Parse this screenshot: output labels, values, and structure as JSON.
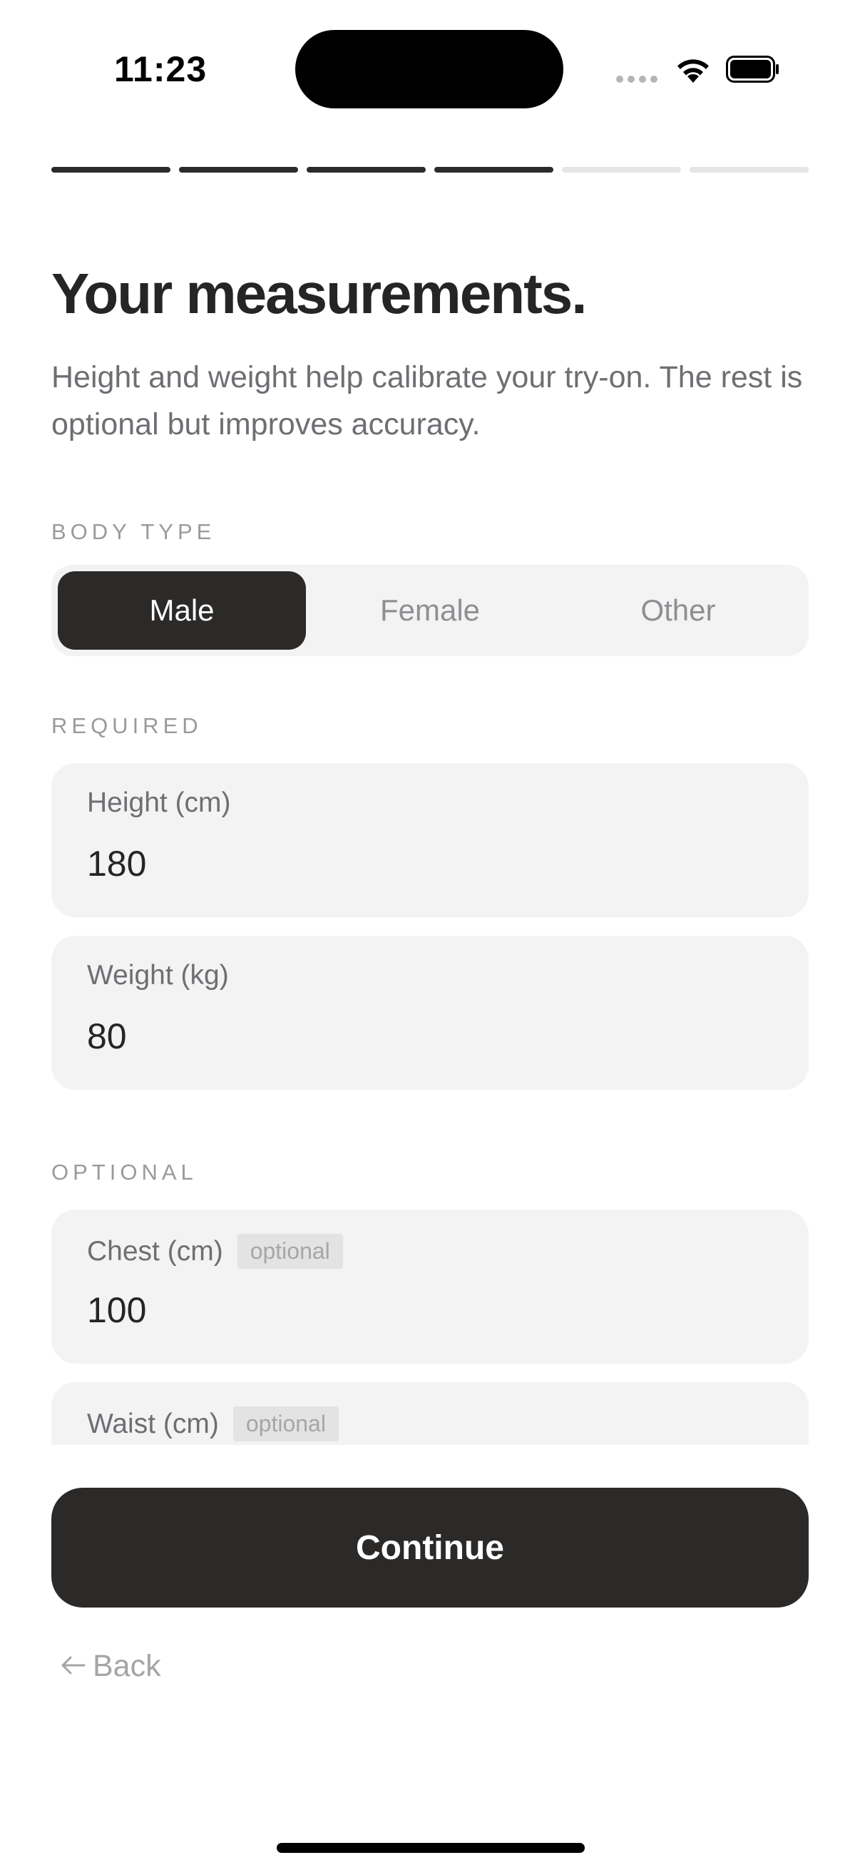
{
  "status_bar": {
    "time": "11:23"
  },
  "progress": {
    "total_steps": 6,
    "completed_steps": 4
  },
  "header": {
    "title": "Your measurements.",
    "subtitle": "Height and weight help calibrate your try-on. The rest is optional but improves accuracy."
  },
  "body_type": {
    "section_label": "BODY TYPE",
    "options": [
      "Male",
      "Female",
      "Other"
    ],
    "selected": "Male"
  },
  "required": {
    "section_label": "REQUIRED",
    "fields": [
      {
        "label": "Height (cm)",
        "value": "180"
      },
      {
        "label": "Weight (kg)",
        "value": "80"
      }
    ]
  },
  "optional": {
    "section_label": "OPTIONAL",
    "badge": "optional",
    "fields": [
      {
        "label": "Chest (cm)",
        "value": "100"
      },
      {
        "label": "Waist (cm)",
        "value": ""
      }
    ]
  },
  "actions": {
    "continue_label": "Continue",
    "back_label": "Back"
  },
  "colors": {
    "accent": "#2b2a29",
    "field_bg": "#f3f3f3",
    "muted_text": "#6e6e73"
  }
}
